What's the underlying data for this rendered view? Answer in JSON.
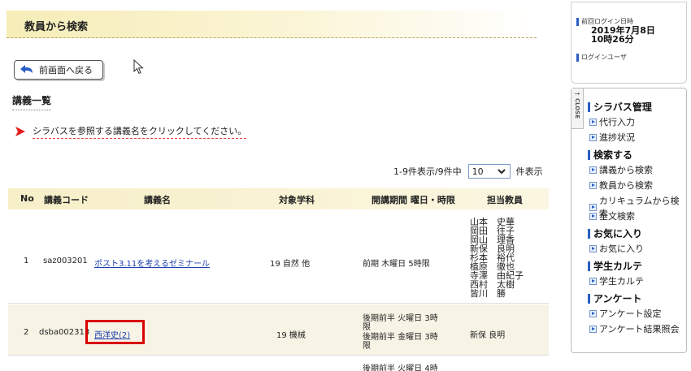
{
  "header": {
    "title": "教員から検索"
  },
  "back_button": {
    "label": "前画面へ戻る"
  },
  "section": {
    "title": "講義一覧"
  },
  "notice": {
    "text": "シラバスを参照する講義名をクリックしてください。"
  },
  "pager": {
    "range_text": "1-9件表示/9件中",
    "per_page": "10",
    "per_page_suffix": "件表示"
  },
  "table": {
    "headers": [
      "No",
      "講義コード",
      "講義名",
      "対象学科",
      "開講期間 曜日・時限",
      "担当教員"
    ],
    "rows": [
      {
        "no": "1",
        "code": "saz003201",
        "name": "ポスト3.11を考えるゼミナール",
        "dept": "19 自然  他",
        "period": "前期  木曜日  5時限",
        "teachers": "山本　史華\n岡田　往子\n岡山　理香\n新保　良明\n杉本　裕代\n植原　徹也\n寺澤　由紀子\n西村　太樹\n皆川　勝"
      },
      {
        "no": "2",
        "code": "dsba002313",
        "name": "西洋史(2)",
        "dept": "19 機械",
        "period_1a": "後期前半  火曜日  3時",
        "period_1b": "限",
        "period_2a": "後期前半  金曜日  3時",
        "period_2b": "限",
        "teachers": "新保  良明"
      },
      {
        "period_partial": "後期前半  火曜日  4時"
      }
    ]
  },
  "login_box": {
    "last_login_label": "前回ログイン日時",
    "last_login_date": "2019年7月8日",
    "last_login_time": "10時26分",
    "user_label": "ログインユーザ"
  },
  "side_panel": {
    "close_label": "CLOSE",
    "groups": [
      {
        "title": "シラバス管理",
        "items": [
          "代行入力",
          "進捗状況"
        ]
      },
      {
        "title": "検索する",
        "items": [
          "講義から検索",
          "教員から検索",
          "カリキュラムから検索",
          "全文検索"
        ]
      },
      {
        "title": "お気に入り",
        "items": [
          "お気に入り"
        ]
      },
      {
        "title": "学生カルテ",
        "items": [
          "学生カルテ"
        ]
      },
      {
        "title": "アンケート",
        "items": [
          "アンケート設定",
          "アンケート結果照会"
        ]
      }
    ]
  },
  "colors": {
    "accent_blue": "#2a5ec4",
    "link": "#1d3fb0",
    "highlight_red": "#d80000",
    "header_band": "#f6edb8"
  }
}
